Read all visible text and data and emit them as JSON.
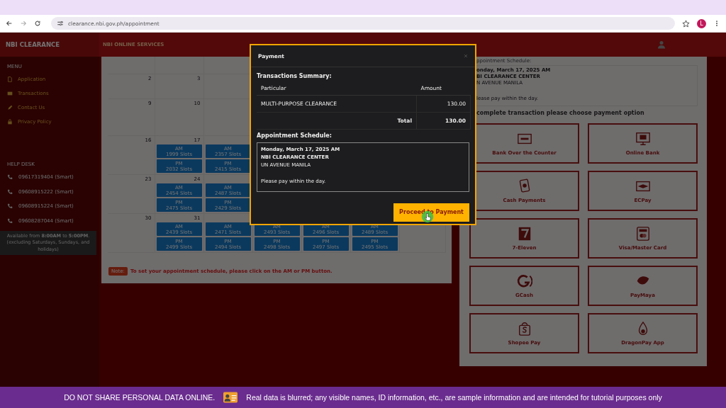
{
  "browser": {
    "url": "clearance.nbi.gov.ph/appointment",
    "profile": "L"
  },
  "header": {
    "brand": "NBI CLEARANCE",
    "section": "NBI ONLINE SERVICES"
  },
  "sidebar": {
    "menu_heading": "MENU",
    "menu": [
      {
        "label": "Application",
        "kind": "doc"
      },
      {
        "label": "Transactions",
        "kind": "card"
      },
      {
        "label": "Contact Us",
        "kind": "pen"
      },
      {
        "label": "Privacy Policy",
        "kind": "lock"
      }
    ],
    "helpdesk_heading": "HELP DESK",
    "phones": [
      "09617319404 (Smart)",
      "09608915222 (Smart)",
      "09608915224 (Smart)",
      "09608287044 (Smart)"
    ],
    "availability": "Available from **8:00AM** to **5:00PM**. (excluding Saturdays, Sundays, and holidays)"
  },
  "calendar": {
    "weeks": [
      {
        "days": [
          {
            "day": "2"
          },
          {
            "day": "3"
          }
        ]
      },
      {
        "days": [
          {
            "day": "9"
          },
          {
            "day": "10"
          }
        ]
      },
      {
        "days": [
          {
            "day": "16"
          },
          {
            "day": "17",
            "slots": [
              {
                "period": "AM",
                "count": "1999 Slots"
              },
              {
                "period": "PM",
                "count": "2032 Slots"
              }
            ]
          },
          {
            "slots": [
              {
                "period": "AM",
                "count": "2357 Slots"
              },
              {
                "period": "PM",
                "count": "2415 Slots"
              }
            ]
          }
        ]
      },
      {
        "days": [
          {
            "day": "23"
          },
          {
            "day": "24",
            "slots": [
              {
                "period": "AM",
                "count": "2454 Slots"
              },
              {
                "period": "PM",
                "count": "2475 Slots"
              }
            ]
          },
          {
            "slots": [
              {
                "period": "AM",
                "count": "2487 Slots"
              },
              {
                "period": "PM",
                "count": "2429 Slots"
              }
            ]
          }
        ]
      },
      {
        "days": [
          {
            "day": "30"
          },
          {
            "day": "31",
            "slots": [
              {
                "period": "AM",
                "count": "2439 Slots"
              },
              {
                "period": "PM",
                "count": "2499 Slots"
              }
            ]
          },
          {
            "slots": [
              {
                "period": "AM",
                "count": "2471 Slots"
              },
              {
                "period": "PM",
                "count": "2494 Slots"
              }
            ]
          },
          {
            "slots": [
              {
                "period": "AM",
                "count": "2493 Slots"
              },
              {
                "period": "PM",
                "count": "2498 Slots"
              }
            ]
          },
          {
            "slots": [
              {
                "period": "AM",
                "count": "2496 Slots"
              },
              {
                "period": "PM",
                "count": "2497 Slots"
              }
            ]
          },
          {
            "slots": [
              {
                "period": "AM",
                "count": "2489 Slots"
              },
              {
                "period": "PM",
                "count": "2495 Slots"
              }
            ]
          }
        ]
      }
    ],
    "note_badge": "Note:",
    "note": "To set your appointment schedule, please click on the AM or PM button."
  },
  "payment_panel": {
    "schedule_heading": "ppointment Schedule:",
    "schedule_lines": [
      "onday, March 17, 2025 AM",
      "BI CLEARANCE CENTER",
      "N AVENUE MANILA",
      "lease pay within the day."
    ],
    "prompt": "complete transaction please choose payment option",
    "options": [
      {
        "label": "Bank Over the Counter",
        "kind": "bank"
      },
      {
        "label": "Online Bank",
        "kind": "monitor"
      },
      {
        "label": "Cash Payments",
        "kind": "cash"
      },
      {
        "label": "ECPay",
        "kind": "ecpay"
      },
      {
        "label": "7-Eleven",
        "kind": "store"
      },
      {
        "label": "Visa/Master Card",
        "kind": "visa"
      },
      {
        "label": "GCash",
        "kind": "gcash"
      },
      {
        "label": "PayMaya",
        "kind": "paymaya"
      },
      {
        "label": "Shopee Pay",
        "kind": "shopee"
      },
      {
        "label": "DragonPay App",
        "kind": "dragon"
      }
    ]
  },
  "modal": {
    "title": "Payment",
    "summary_heading": "Transactions Summary:",
    "columns": [
      "Particular",
      "Amount"
    ],
    "rows": [
      {
        "particular": "MULTI-PURPOSE CLEARANCE",
        "amount": "130.00"
      }
    ],
    "total_label": "Total",
    "total": "130.00",
    "schedule_heading": "Appointment Schedule:",
    "schedule": {
      "date": "Monday, March 17, 2025 AM",
      "center": "NBI CLEARANCE CENTER",
      "address": "UN AVENUE MANILA",
      "note": "Please pay within the day."
    },
    "button": "Proceed to Payment"
  },
  "banner": {
    "warning": "DO NOT SHARE PERSONAL DATA ONLINE.",
    "message": "Real data is blurred; any visible names, ID information, etc., are sample information and are intended for tutorial purposes only"
  }
}
